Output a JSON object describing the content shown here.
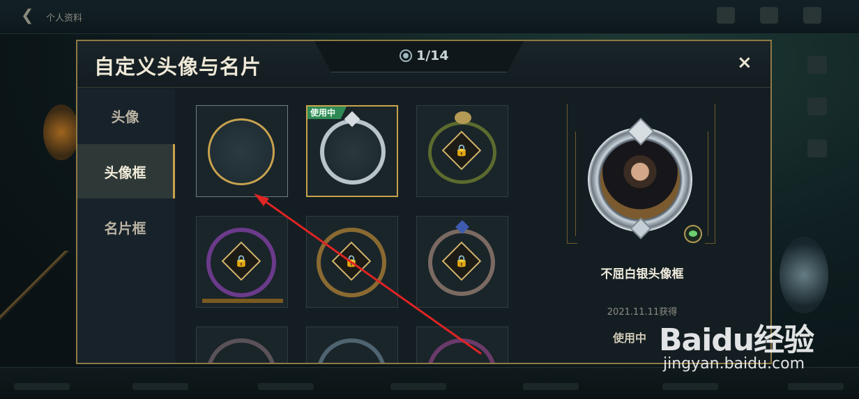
{
  "background": {
    "title": "个人资料",
    "tab1": "",
    "tab2": ""
  },
  "modal": {
    "title": "自定义头像与名片",
    "counter": "1/14",
    "close_glyph": "×",
    "accent": "#c9a24e"
  },
  "sidebar": {
    "items": [
      {
        "label": "头像",
        "active": false
      },
      {
        "label": "头像框",
        "active": true
      },
      {
        "label": "名片框",
        "active": false
      }
    ]
  },
  "grid": {
    "tiles": [
      {
        "name": "default-frame",
        "locked": false,
        "in_use": false
      },
      {
        "name": "silver-frame",
        "locked": false,
        "in_use": true,
        "badge": "使用中"
      },
      {
        "name": "wechat-frame",
        "locked": true,
        "in_use": false
      },
      {
        "name": "purple-horn-frame",
        "locked": true,
        "in_use": false
      },
      {
        "name": "bronze-frame",
        "locked": true,
        "in_use": false
      },
      {
        "name": "gothic-frame",
        "locked": true,
        "in_use": false
      },
      {
        "name": "row3-frame-1",
        "locked": true,
        "in_use": false
      },
      {
        "name": "row3-frame-2",
        "locked": true,
        "in_use": false
      },
      {
        "name": "row3-frame-3",
        "locked": true,
        "in_use": false
      }
    ],
    "lock_glyph": "🔒"
  },
  "preview": {
    "name": "不屈白银头像框",
    "date": "2021.11.11获得",
    "status": "使用中"
  },
  "watermark": {
    "logo": "Baidu经验",
    "sub": "jingyan.baidu.com"
  }
}
